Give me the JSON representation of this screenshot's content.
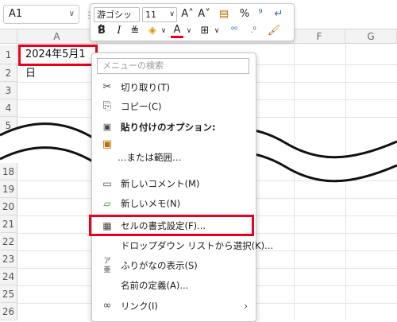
{
  "formula_bar": {
    "name_box": "A1",
    "name_box_arrow": "∨",
    "separator": "⋮"
  },
  "columns": [
    "A",
    "F",
    "G"
  ],
  "rows_top": [
    "1",
    "2",
    "3",
    "4",
    "5"
  ],
  "rows_bottom": [
    "18",
    "19",
    "20",
    "21",
    "22",
    "23",
    "24",
    "25",
    "26"
  ],
  "cell_a1": "2024年5月1日",
  "mini_toolbar": {
    "font_name": "游ゴシック",
    "font_size": "11",
    "grow_font": "A˄",
    "shrink_font": "A˅",
    "percent": "%",
    "bold": "B",
    "italic": "I",
    "align": "≡",
    "font_color": "A",
    "font_color_hex": "#e8001c"
  },
  "context_menu": {
    "search_placeholder": "メニューの検索",
    "items": [
      {
        "label": "切り取り(T)",
        "icon": "scissors-icon",
        "glyph": "✂"
      },
      {
        "label": "コピー(C)",
        "icon": "copy-icon",
        "glyph": "⎘"
      },
      {
        "label": "貼り付けのオプション:",
        "icon": "paste-icon",
        "glyph": "📋"
      },
      {
        "label": "…または範囲…",
        "icon": "paste-partial-icon",
        "glyph": ""
      },
      {
        "label": "新しいコメント(M)",
        "icon": "comment-icon",
        "glyph": "🗨"
      },
      {
        "label": "新しいメモ(N)",
        "icon": "note-icon",
        "glyph": "🗒"
      },
      {
        "label": "セルの書式設定(F)...",
        "icon": "format-cells-icon",
        "glyph": "▦"
      },
      {
        "label": "ドロップダウン リストから選択(K)...",
        "icon": "",
        "glyph": ""
      },
      {
        "label": "ふりがなの表示(S)",
        "icon": "furigana-icon",
        "glyph": "ア"
      },
      {
        "label": "名前の定義(A)...",
        "icon": "",
        "glyph": ""
      },
      {
        "label": "リンク(I)",
        "icon": "link-icon",
        "glyph": "🔗",
        "submenu": "›"
      }
    ]
  },
  "colors": {
    "highlight": "#e8001c",
    "header_bg": "#f3f3f3"
  }
}
